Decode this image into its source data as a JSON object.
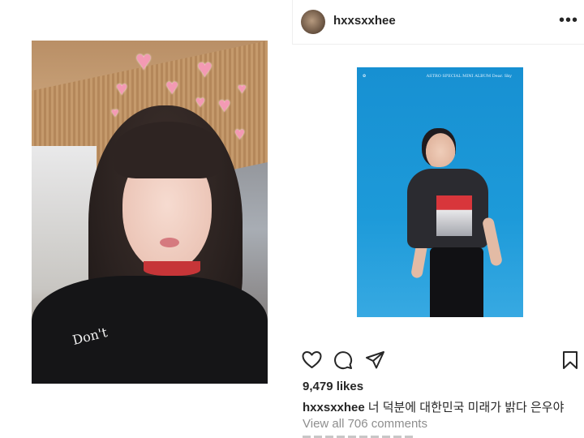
{
  "left_photo": {
    "shirt_text": "Don't",
    "heart_glyph": "♥"
  },
  "post": {
    "username": "hxxsxxhee",
    "more_icon": "more-options-icon",
    "image": {
      "album_left_text": "✿",
      "album_right_text": "ASTRO SPECIAL MINI ALBUM  Dear. Sky"
    },
    "actions": [
      "heart-icon",
      "comment-icon",
      "share-icon",
      "bookmark-icon"
    ],
    "likes": "9,479 likes",
    "caption": {
      "username": "hxxsxxhee",
      "text": "너 덕분에 대한민국 미래가 밝다 은우야"
    },
    "view_comments": "View all 706 comments"
  },
  "colors": {
    "text": "#262626",
    "muted": "#8e8e8e",
    "divider": "#efefef",
    "post_bg_blue": "#1d9ad9"
  }
}
